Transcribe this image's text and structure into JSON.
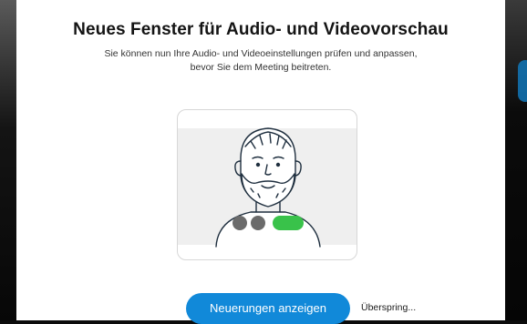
{
  "dialog": {
    "title": "Neues Fenster für Audio- und Videovorschau",
    "subtitle": "Sie können nun Ihre Audio- und Videoeinstellungen prüfen und anpassen, bevor Sie dem Meeting beitreten.",
    "primary_button": "Neuerungen anzeigen",
    "skip_link": "Überspring..."
  },
  "illustration": {
    "icons": [
      "avatar-illustration",
      "mic-toggle-icon",
      "camera-toggle-icon",
      "join-call-icon"
    ],
    "colors": {
      "accent": "#1189d9",
      "join": "#39c24a",
      "control": "#6b6b6b"
    }
  }
}
